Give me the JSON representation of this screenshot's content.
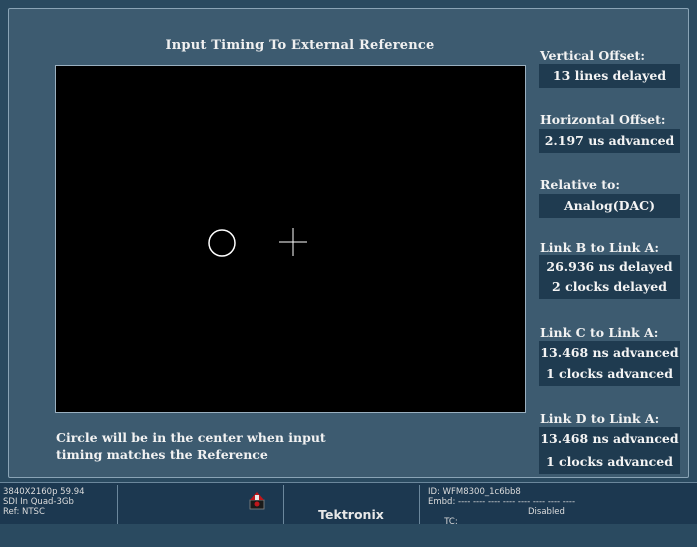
{
  "display": {
    "title": "Input Timing To External Reference",
    "caption_line1": "Circle will be in the center when input",
    "caption_line2": "timing matches the Reference",
    "circle_color": "#ffffff",
    "crosshair_color": "#ffffff"
  },
  "panel": {
    "vertical_offset_label": "Vertical Offset:",
    "vertical_offset_value": "13 lines delayed",
    "horizontal_offset_label": "Horizontal Offset:",
    "horizontal_offset_value": "2.197 us advanced",
    "relative_to_label": "Relative to:",
    "relative_to_value": "Analog(DAC)",
    "link_b_label": "Link B to Link A:",
    "link_b_time": "26.936 ns delayed",
    "link_b_clocks": "2 clocks delayed",
    "link_c_label": "Link C to Link A:",
    "link_c_time": "13.468 ns advanced",
    "link_c_clocks": "1 clocks advanced",
    "link_d_label": "Link D to Link A:",
    "link_d_time": "13.468 ns advanced",
    "link_d_clocks": "1 clocks advanced"
  },
  "status": {
    "format": "3840X2160p 59.94",
    "input": "SDI In Quad-3Gb",
    "reference": "Ref: NTSC",
    "brand": "Tektronix",
    "id": "ID: WFM8300_1c6bb8",
    "embd": "Embd: ---- ---- ---- ---- ---- ---- ---- ----",
    "tc_label": "TC:",
    "tc_state": "Disabled",
    "alarm_icon": "alarm-icon",
    "alarm_color": "#c0161b"
  }
}
